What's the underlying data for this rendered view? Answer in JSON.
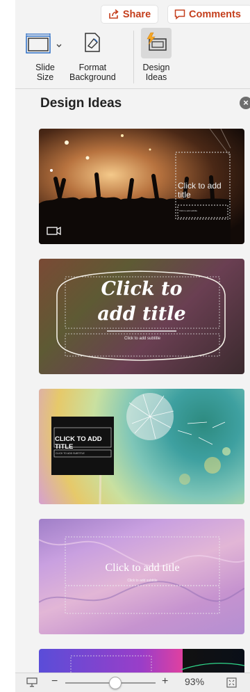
{
  "toolbar": {
    "share_label": "Share",
    "comments_label": "Comments"
  },
  "ribbon": {
    "slide_size": "Slide\nSize",
    "slide_size_l1": "Slide",
    "slide_size_l2": "Size",
    "format_bg_l1": "Format",
    "format_bg_l2": "Background",
    "design_ideas_l1": "Design",
    "design_ideas_l2": "Ideas"
  },
  "panel": {
    "title": "Design Ideas",
    "close_icon": "close-icon"
  },
  "designs": [
    {
      "title": "Click to add title",
      "subtitle": "Click to add subtitle",
      "theme": "concert-photo"
    },
    {
      "title": "Click to add title",
      "subtitle": "Click to add subtitle",
      "theme": "chalkboard-script"
    },
    {
      "title": "CLICK TO ADD TITLE",
      "subtitle": "CLICK TO ADD SUBTITLE",
      "theme": "dandelion"
    },
    {
      "title": "Click to add title",
      "subtitle": "Click to add subtitle",
      "theme": "pink-marble"
    },
    {
      "title": "",
      "subtitle": "",
      "theme": "purple-gradient"
    }
  ],
  "statusbar": {
    "zoom": "93%",
    "zoom_minus": "−",
    "zoom_plus": "+",
    "zoom_level": 0.55
  },
  "colors": {
    "accent": "#c43e1c",
    "design_icon": "#f5a623"
  }
}
